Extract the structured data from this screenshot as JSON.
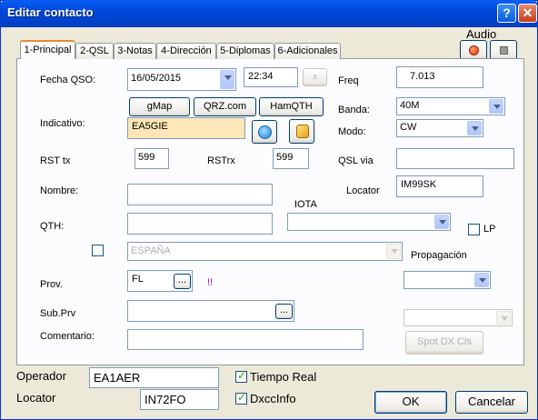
{
  "window": {
    "title": "Editar contacto",
    "help_label": "?",
    "close_label": "✕"
  },
  "audio": {
    "label": "Audio"
  },
  "tabs": [
    {
      "label": "1-Principal"
    },
    {
      "label": "2-QSL"
    },
    {
      "label": "3-Notas"
    },
    {
      "label": "4-Dirección"
    },
    {
      "label": "5-Diplomas"
    },
    {
      "label": "6-Adicionales"
    }
  ],
  "fields": {
    "fecha_qso": {
      "label": "Fecha QSO:",
      "date": "16/05/2015",
      "time": "22:34",
      "clear": "x"
    },
    "freq": {
      "label": "Freq",
      "value": "7.013"
    },
    "banda": {
      "label": "Banda:",
      "value": "40M"
    },
    "modo": {
      "label": "Modo:",
      "value": "CW"
    },
    "indicativo": {
      "label": "Indicativo:",
      "value": "EA5GIE"
    },
    "lookup_buttons": {
      "gmap": "gMap",
      "qrz": "QRZ.com",
      "hamqth": "HamQTH"
    },
    "rst_tx": {
      "label": "RST tx",
      "value": "599"
    },
    "rst_rx": {
      "label": "RSTrx",
      "value": "599"
    },
    "qsl_via": {
      "label": "QSL via",
      "value": ""
    },
    "nombre": {
      "label": "Nombre:",
      "value": ""
    },
    "locator": {
      "label": "Locator",
      "value": "IM99SK"
    },
    "iota": {
      "label": "IOTA",
      "value": ""
    },
    "qth": {
      "label": "QTH:",
      "value": ""
    },
    "lp": {
      "label": "LP"
    },
    "pais": {
      "value": "ESPAÑA"
    },
    "propagacion": {
      "label": "Propagación",
      "value": ""
    },
    "prov": {
      "label": "Prov.",
      "value": "FL",
      "more": "...",
      "warn": "!!"
    },
    "sub_prv": {
      "label": "Sub.Prv",
      "value": "",
      "more": "..."
    },
    "comentario": {
      "label": "Comentario:",
      "value": ""
    },
    "spot_dx": {
      "label": "Spot DX Cls"
    }
  },
  "bottom": {
    "operador": {
      "label": "Operador",
      "value": "EA1AER"
    },
    "locator": {
      "label": "Locator",
      "value": "IN72FO"
    },
    "tiempo_real": {
      "label": "Tiempo Real",
      "checked": true
    },
    "dxccinfo": {
      "label": "DxccInfo",
      "checked": true
    },
    "ok": "OK",
    "cancel": "Cancelar"
  },
  "colors": {
    "title_bar": "#0a5ef5",
    "indicativo_bg": "#ffe6b8",
    "accent_tab": "#e68b2c"
  }
}
